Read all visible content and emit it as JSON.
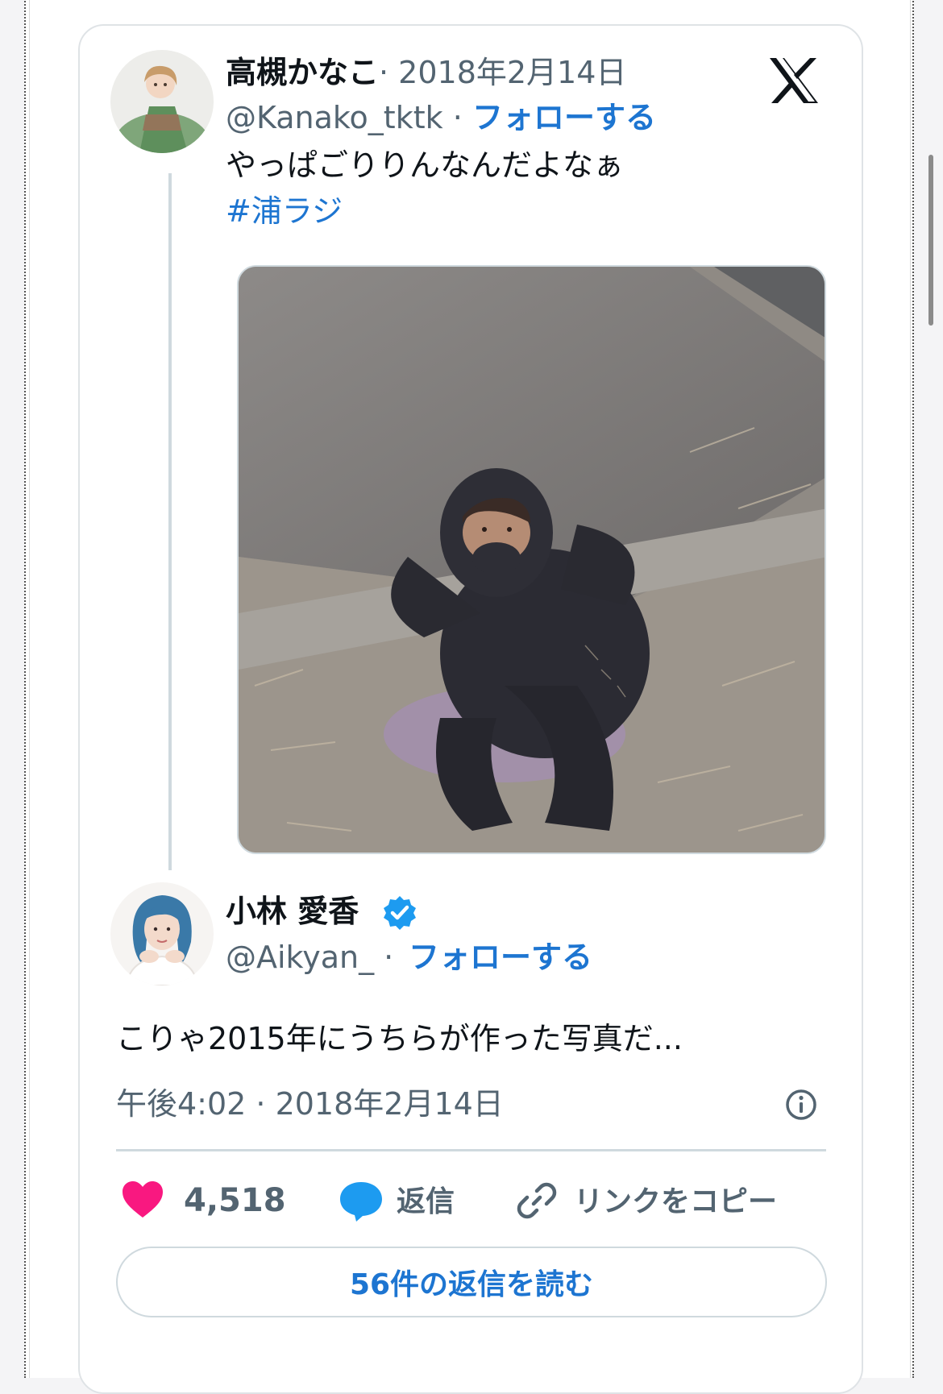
{
  "original_tweet": {
    "display_name": "高槻かなこ",
    "date": "· 2018年2月14日",
    "handle": "@Kanako_tktk ·",
    "follow_label": "フォローする",
    "text": "やっぱごりりんなんだよなぁ",
    "hashtag": "#浦ラジ",
    "avatar_icon": "user-avatar-photo",
    "image_icon": "attached-photo"
  },
  "reply_tweet": {
    "display_name": "小林 愛香",
    "verified_icon": "verified-badge-icon",
    "handle": "@Aikyan_ ·",
    "follow_label": "フォローする",
    "text": "こりゃ2015年にうちらが作った写真だ...",
    "timestamp": "午後4:02 · 2018年2月14日"
  },
  "actions": {
    "likes": "4,518",
    "reply_label": "返信",
    "copy_link_label": "リンクをコピー"
  },
  "read_replies_label": "56件の返信を読む",
  "colors": {
    "link_blue": "#1d75d1",
    "heart_pink": "#f91880",
    "verified_blue": "#1d9bf0",
    "muted_gray": "#536471"
  }
}
